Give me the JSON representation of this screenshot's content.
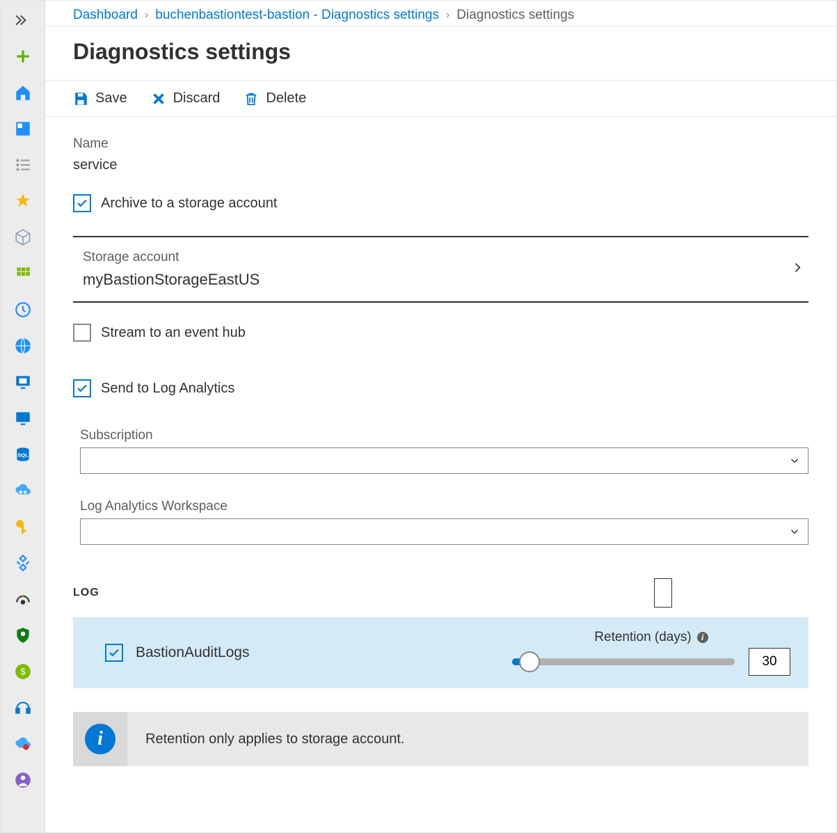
{
  "breadcrumb": {
    "items": [
      "Dashboard",
      "buchenbastiontest-bastion - Diagnostics settings",
      "Diagnostics settings"
    ]
  },
  "page": {
    "title": "Diagnostics settings"
  },
  "toolbar": {
    "save": "Save",
    "discard": "Discard",
    "delete": "Delete"
  },
  "form": {
    "name_label": "Name",
    "name_value": "service",
    "archive_label": "Archive to a storage account",
    "storage_label": "Storage account",
    "storage_value": "myBastionStorageEastUS",
    "stream_label": "Stream to an event hub",
    "send_la_label": "Send to Log Analytics",
    "subscription_label": "Subscription",
    "law_label": "Log Analytics Workspace",
    "log_section": "LOG",
    "log_item": "BastionAuditLogs",
    "retention_label": "Retention (days)",
    "retention_value": "30",
    "info_msg": "Retention only applies to storage account."
  }
}
